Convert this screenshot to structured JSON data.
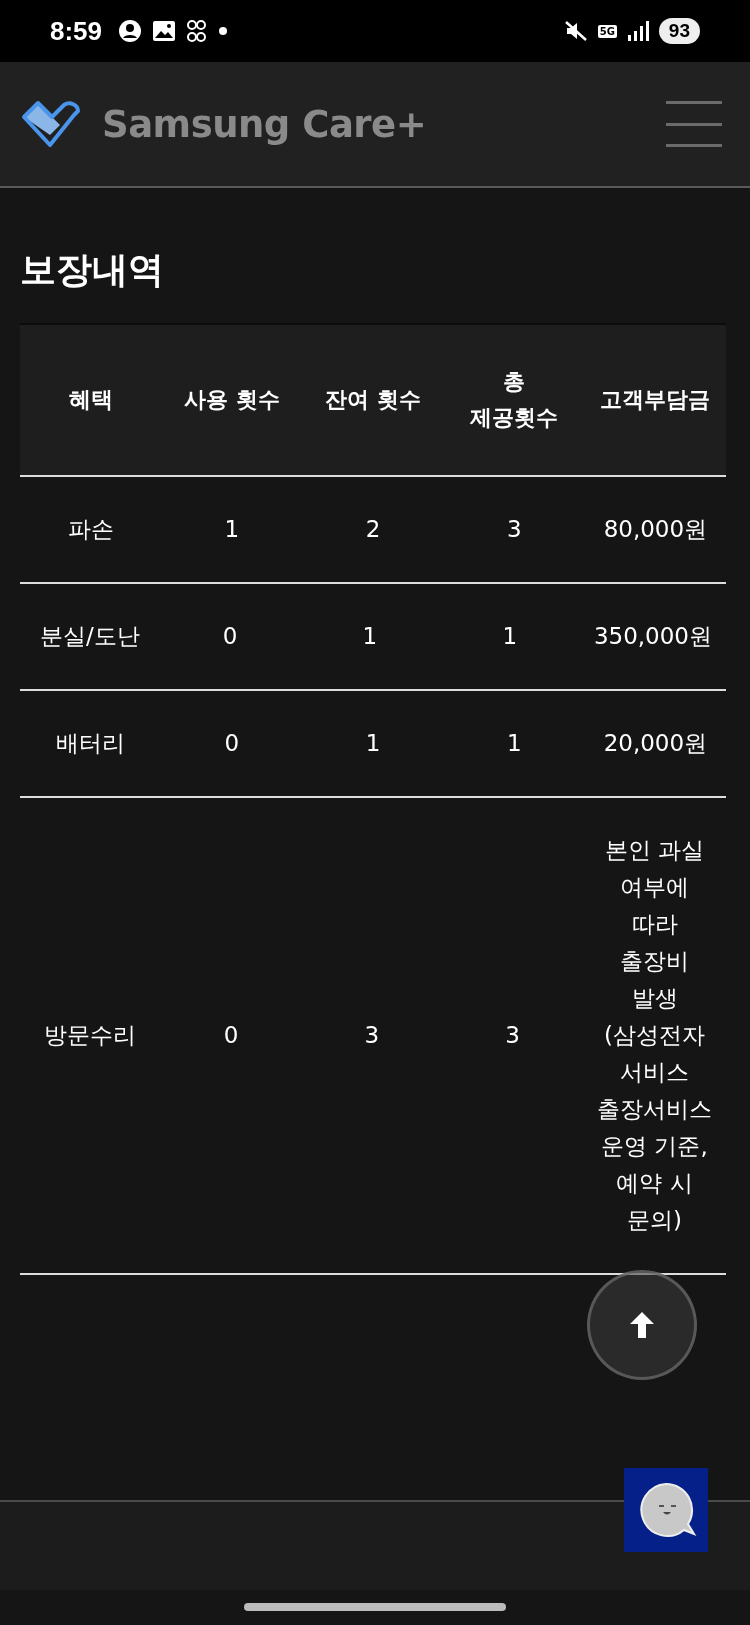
{
  "status_bar": {
    "time": "8:59",
    "network": "5G",
    "battery": "93"
  },
  "header": {
    "brand": "Samsung Care+"
  },
  "page_title": "보장내역",
  "table": {
    "columns": [
      "혜택",
      "사용 횟수",
      "잔여 횟수",
      "총\n제공횟수",
      "고객부담금"
    ],
    "rows": [
      {
        "cells": [
          "파손",
          "1",
          "2",
          "3",
          "80,000원"
        ]
      },
      {
        "cells": [
          "분실/도난",
          "0",
          "1",
          "1",
          "350,000원"
        ]
      },
      {
        "cells": [
          "배터리",
          "0",
          "1",
          "1",
          "20,000원"
        ]
      },
      {
        "cells": [
          "방문수리",
          "0",
          "3",
          "3",
          "본인 과실 여부에 따라 출장비 발생 (삼성전자 서비스 출장서비스 운영 기준, 예약 시 문의)"
        ]
      }
    ]
  }
}
